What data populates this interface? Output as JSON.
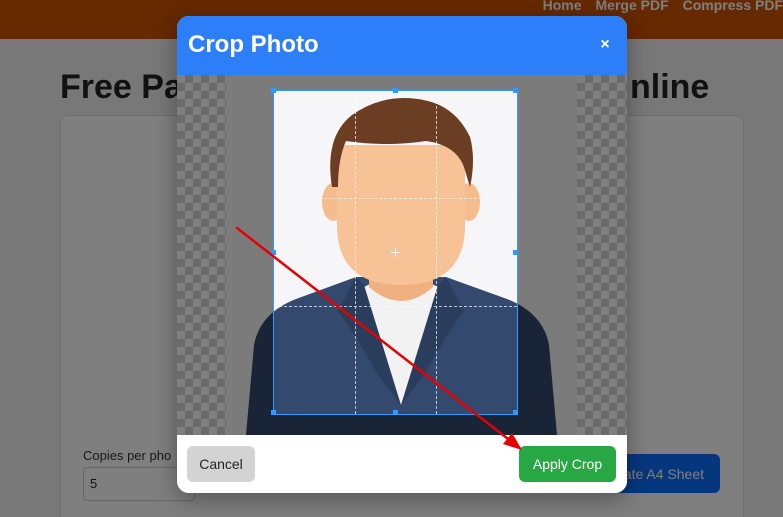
{
  "nav": {
    "items": [
      "Home",
      "Merge PDF",
      "Compress PDF"
    ]
  },
  "page": {
    "title_left": "Free Pa",
    "title_right": "nline",
    "copies_label": "Copies per pho",
    "copies_value": "5",
    "generate_label": "ate A4 Sheet"
  },
  "modal": {
    "title": "Crop Photo",
    "close_symbol": "×",
    "cancel_label": "Cancel",
    "apply_label": "Apply Crop"
  },
  "colors": {
    "nav_bar": "#cc5200",
    "modal_header": "#2d7ff9",
    "apply_button": "#28a745",
    "cancel_button": "#d3d3d3",
    "crop_border": "#3399ff",
    "annotation_arrow": "#e60000"
  }
}
